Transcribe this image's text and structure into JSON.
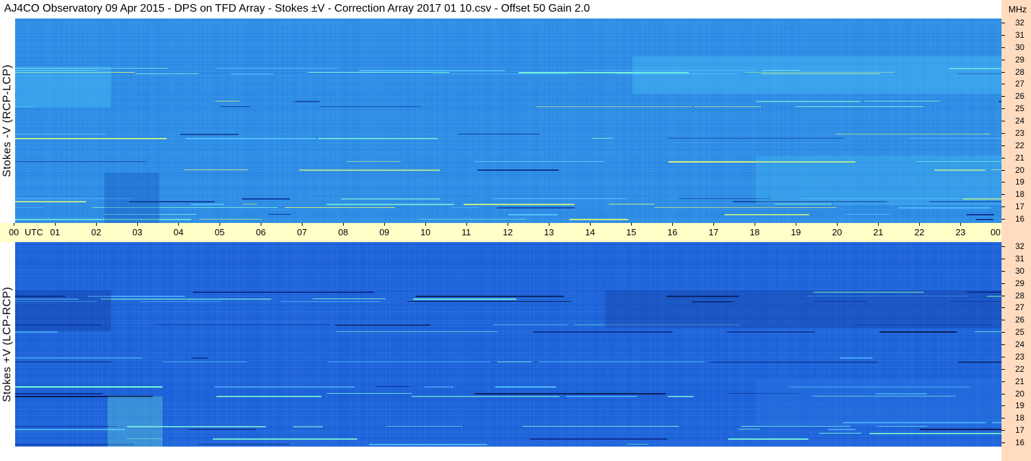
{
  "title": "AJ4CO Observatory  09 Apr 2015  -  DPS on TFD Array  -  Stokes ±V  -  Correction Array 2017 01 10.csv  -  Offset 50  Gain 2.0",
  "panels": {
    "top": {
      "label": "Stokes -V (RCP-LCP)"
    },
    "bottom": {
      "label": "Stokes +V (LCP-RCP)"
    }
  },
  "chart_data": {
    "type": "heatmap",
    "time_axis": {
      "unit_label": "UTC",
      "ticks": [
        "00",
        "01",
        "02",
        "03",
        "04",
        "05",
        "06",
        "07",
        "08",
        "09",
        "10",
        "11",
        "12",
        "13",
        "14",
        "15",
        "16",
        "17",
        "18",
        "19",
        "20",
        "21",
        "22",
        "23",
        "00"
      ]
    },
    "freq_axis": {
      "unit_label": "MHz",
      "range": [
        16,
        32
      ],
      "ticks": [
        "32",
        "31",
        "30",
        "29",
        "28",
        "27",
        "26",
        "25",
        "24",
        "23",
        "22",
        "21",
        "20",
        "19",
        "18",
        "17",
        "16"
      ]
    },
    "panels": [
      {
        "label": "Stokes -V (RCP-LCP)",
        "base_color": "#2f8fe6"
      },
      {
        "label": "Stokes +V (LCP-RCP)",
        "base_color": "#1e63da"
      }
    ]
  },
  "colors": {
    "time_strip": "#ffffc8",
    "freq_column": "#ffdcc0"
  }
}
